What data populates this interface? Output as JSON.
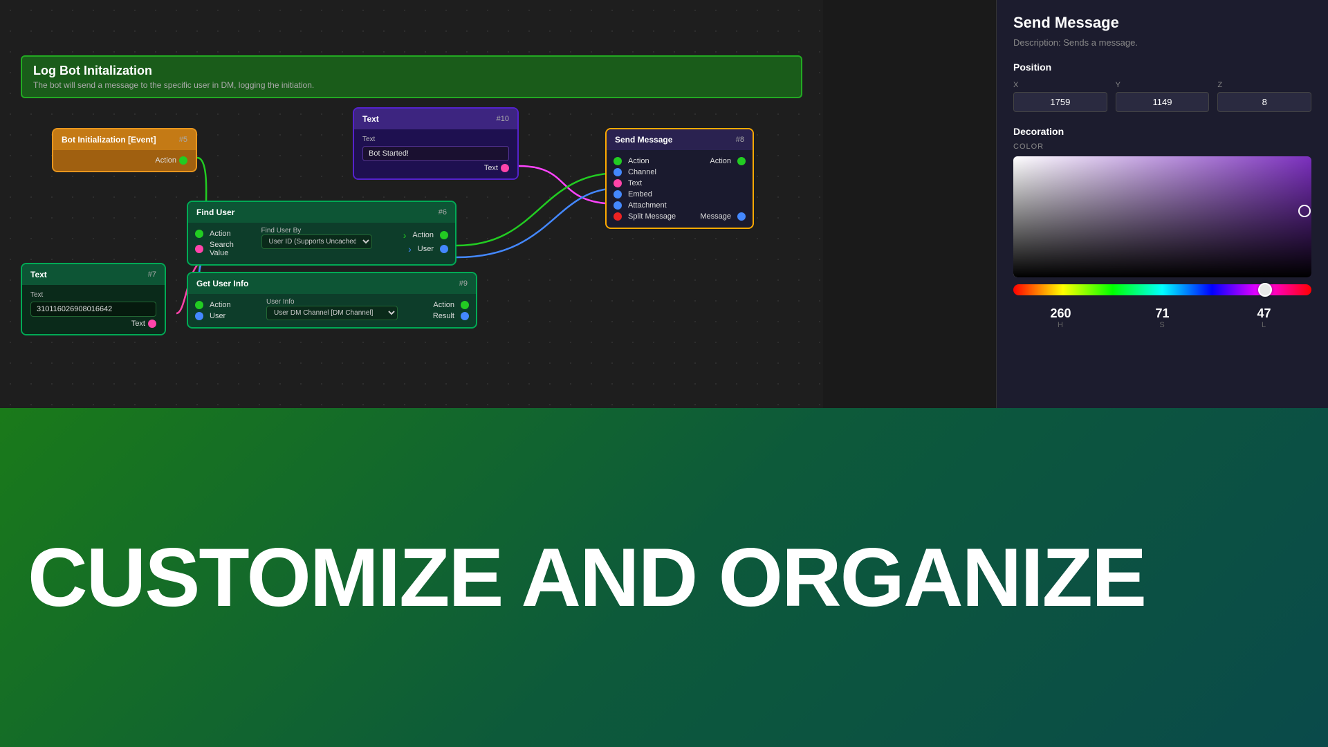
{
  "header": {
    "title": "Log Bot Initalization",
    "description": "The bot will send a message to the specific user in DM, logging the initiation."
  },
  "nodes": {
    "bot_init": {
      "title": "Bot Initialization [Event]",
      "id": "#5",
      "output": "Action"
    },
    "text_10": {
      "title": "Text",
      "id": "#10",
      "field_label": "Text",
      "field_value": "Bot Started!",
      "output": "Text"
    },
    "send_message": {
      "title": "Send Message",
      "id": "#8",
      "inputs": [
        "Action",
        "Channel",
        "Text",
        "Embed",
        "Attachment",
        "Split Message"
      ],
      "outputs": [
        "Action",
        "Message"
      ]
    },
    "find_user": {
      "title": "Find User",
      "id": "#6",
      "inputs": [
        "Action",
        "Search Value"
      ],
      "field_label": "Find User By",
      "field_value": "User ID (Supports Uncached User)",
      "outputs": [
        "Action",
        "User"
      ]
    },
    "text_7": {
      "title": "Text",
      "id": "#7",
      "field_label": "Text",
      "field_value": "310116026908016642",
      "output": "Text"
    },
    "get_user_info": {
      "title": "Get User Info",
      "id": "#9",
      "inputs": [
        "Action",
        "User"
      ],
      "field_label": "User Info",
      "field_value": "User DM Channel [DM Channel]",
      "outputs": [
        "Action",
        "Result"
      ]
    }
  },
  "right_panel": {
    "title": "Send Message",
    "description_label": "Description:",
    "description": "Sends a message.",
    "position_section": "Position",
    "pos_x_label": "X",
    "pos_x_value": "1759",
    "pos_y_label": "Y",
    "pos_y_value": "1149",
    "pos_z_label": "Z",
    "pos_z_value": "8",
    "decoration_title": "Decoration",
    "color_label": "COLOR",
    "hue_h": "260",
    "hue_s": "71",
    "hue_l": "47",
    "hue_h_label": "H",
    "hue_s_label": "S",
    "hue_l_label": "L"
  },
  "banner": {
    "text": "CUSTOMIZE AND ORGANIZE"
  }
}
